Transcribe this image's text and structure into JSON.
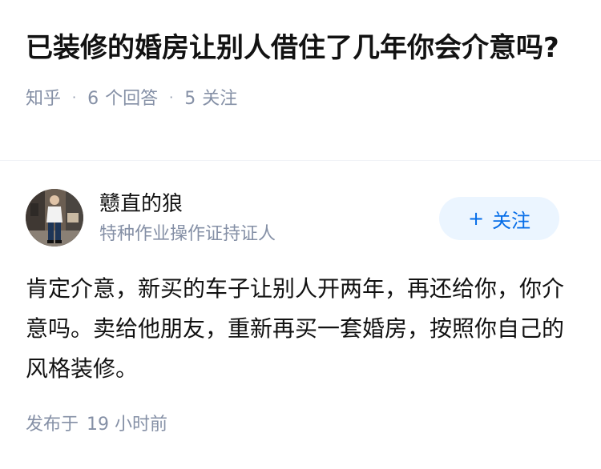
{
  "question": {
    "title": "已装修的婚房让别人借住了几年你会介意吗?",
    "source": "知乎",
    "separator": "·",
    "answers_count": "6",
    "answers_label": "个回答",
    "followers_count": "5",
    "followers_label": "关注"
  },
  "answer": {
    "author": {
      "name": "戆直的狼",
      "bio": "特种作业操作证持证人",
      "avatar_icon": "avatar-photo"
    },
    "follow_button": {
      "icon": "plus",
      "label": "关注"
    },
    "content": "肯定介意，新买的车子让别人开两年，再还给你，你介意吗。卖给他朋友，重新再买一套婚房，按照你自己的风格装修。",
    "published_label": "发布于",
    "published_time": "19 小时前"
  },
  "colors": {
    "text_primary": "#121212",
    "text_secondary": "#8590a6",
    "accent": "#056de8",
    "button_bg": "#ebf5ff"
  }
}
